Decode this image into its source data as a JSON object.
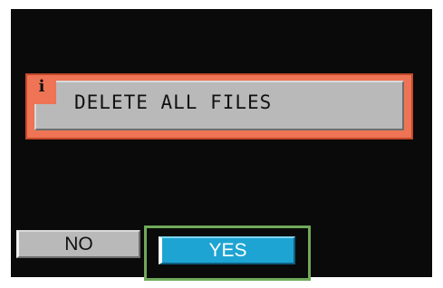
{
  "dialog": {
    "icon": "info-icon",
    "icon_glyph": "i",
    "message": "DELETE ALL FILES"
  },
  "buttons": {
    "no_label": "NO",
    "yes_label": "YES",
    "selected": "YES"
  },
  "colors": {
    "background": "#0a0a0a",
    "dialog_accent": "#ee7455",
    "message_box": "#b9b9b9",
    "yes_button": "#1ea4d2",
    "selection_frame": "#6fa95a"
  }
}
